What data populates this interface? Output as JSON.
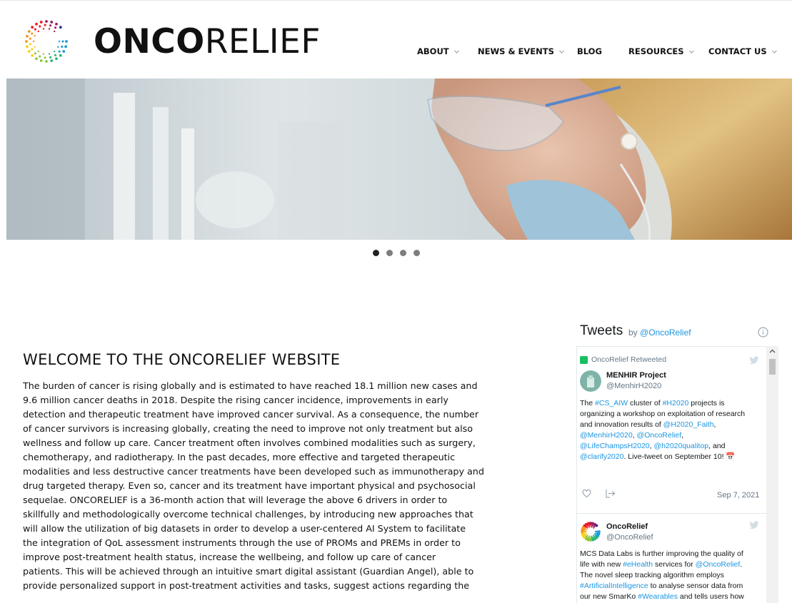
{
  "brand": {
    "bold": "ONCO",
    "light": "RELIEF"
  },
  "nav": {
    "items": [
      {
        "label": "ABOUT",
        "dropdown": true
      },
      {
        "label": "NEWS & EVENTS",
        "dropdown": true
      },
      {
        "label": "BLOG",
        "dropdown": false
      },
      {
        "label": "RESOURCES",
        "dropdown": true
      },
      {
        "label": "CONTACT US",
        "dropdown": true
      }
    ]
  },
  "carousel": {
    "slides": 4,
    "active": 1
  },
  "main": {
    "heading": "WELCOME TO THE ONCORELIEF WEBSITE",
    "lines": [
      "The burden of cancer is rising globally and is estimated to have reached 18.1 million new cases and",
      "9.6 million cancer deaths in 2018. Despite the rising cancer incidence, improvements in early",
      "detection and therapeutic treatment have improved cancer survival. As a consequence, the number",
      "of cancer survivors is increasing globally, creating the need to improve not only treatment but also",
      "wellness and follow up care. Cancer treatment often involves combined modalities such as surgery,",
      "chemotherapy, and radiotherapy. In the past decades, more effective and targeted therapeutic",
      "modalities and less destructive cancer treatments have been developed such as immunotherapy and",
      "drug targeted therapy. Even so, cancer and its treatment have important physical and psychosocial",
      "sequelae. ONCORELIEF is a 36-month action that will leverage the above 6 drivers in order to",
      "skillfully and methodologically overcome technical challenges, by introducing new approaches that",
      "will allow the utilization of big datasets in order to develop a user-centered AI System to facilitate",
      "the integration of QoL assessment instruments through the use of PROMs and PREMs in order to",
      "improve post-treatment health status, increase the wellbeing, and follow up care of cancer",
      "patients. This will be achieved through an intuitive smart digital assistant (Guardian Angel), able to",
      "provide personalized support in post-treatment activities and tasks, suggest actions regarding the"
    ]
  },
  "twitter": {
    "title": "Tweets",
    "by": "by",
    "handle": "@OncoRelief",
    "tweets": [
      {
        "retweeted_by": "OncoRelief Retweeted",
        "name": "MENHIR Project",
        "handle": "@MenhirH2020",
        "lines": [
          [
            [
              "The ",
              false
            ],
            [
              "#CS_AIW",
              true
            ],
            [
              " cluster of ",
              false
            ],
            [
              "#H2020",
              true
            ],
            [
              " projects is",
              false
            ]
          ],
          [
            [
              "organizing a workshop on exploitation of research",
              false
            ]
          ],
          [
            [
              "and innovation results of ",
              false
            ],
            [
              "@H2020_Faith",
              true
            ],
            [
              ",",
              false
            ]
          ],
          [
            [
              "@MenhirH2020",
              true
            ],
            [
              ", ",
              false
            ],
            [
              "@OncoRelief",
              true
            ],
            [
              ",",
              false
            ]
          ],
          [
            [
              "@LifeChampsH2020",
              true
            ],
            [
              ", ",
              false
            ],
            [
              "@h2020qualitop",
              true
            ],
            [
              ", and",
              false
            ]
          ],
          [
            [
              "@clarify2020",
              true
            ],
            [
              ". Live-tweet on September 10! 📅",
              false
            ]
          ]
        ],
        "date": "Sep 7, 2021"
      },
      {
        "name": "OncoRelief",
        "handle": "@OncoRelief",
        "lines": [
          [
            [
              "MCS Data Labs is further improving the quality of",
              false
            ]
          ],
          [
            [
              "life with new ",
              false
            ],
            [
              "#eHealth",
              true
            ],
            [
              " services for ",
              false
            ],
            [
              "@OncoRelief",
              true
            ],
            [
              ".",
              false
            ]
          ],
          [
            [
              "The novel sleep tracking algorithm employs",
              false
            ]
          ],
          [
            [
              "#ArtificialIntelligence",
              true
            ],
            [
              " to analyse sensor data from",
              false
            ]
          ],
          [
            [
              "our new SmarKo ",
              false
            ],
            [
              "#Wearables",
              true
            ],
            [
              " and tells users how",
              false
            ]
          ]
        ]
      }
    ]
  },
  "colors": {
    "link": "#1b95e0",
    "text": "#111111",
    "muted": "#657786"
  }
}
